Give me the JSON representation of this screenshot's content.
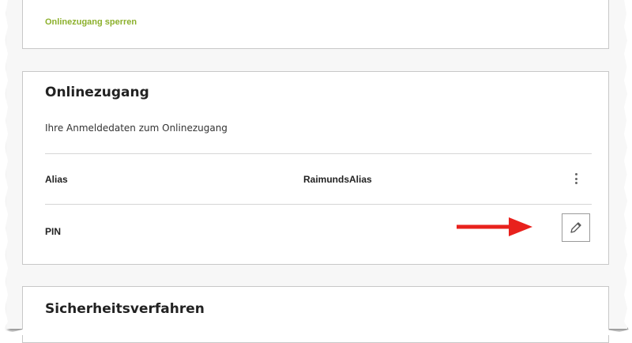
{
  "top_card": {
    "lock_link": "Onlinezugang sperren"
  },
  "online_access": {
    "title": "Onlinezugang",
    "subtitle": "Ihre Anmeldedaten zum Onlinezugang",
    "rows": [
      {
        "label": "Alias",
        "value": "RaimundsAlias",
        "action_icon": "more-vertical-icon"
      },
      {
        "label": "PIN",
        "value": "",
        "action_icon": "pencil-icon"
      }
    ]
  },
  "security_card": {
    "title": "Sicherheitsverfahren"
  },
  "annotation": {
    "icon": "red-arrow-icon",
    "color": "#e8211d"
  },
  "colors": {
    "accent_link": "#8cb02c"
  }
}
